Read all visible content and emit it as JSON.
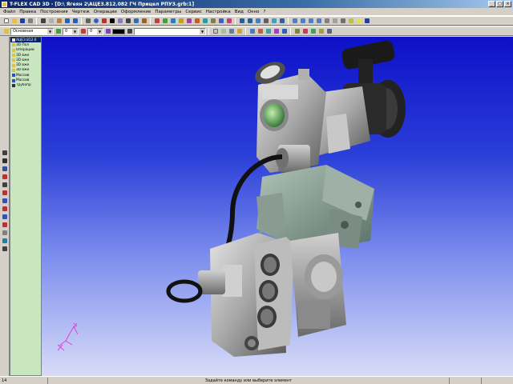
{
  "window": {
    "title": "T-FLEX CAD 3D - [D:\\ Ягеян 2\\АЦЕЗ.812.082 ГЧ Прицел РПУЗ.grb:1]",
    "buttons": [
      "_",
      "□",
      "×"
    ]
  },
  "menu": [
    "Файл",
    "Правка",
    "Построения",
    "Чертеж",
    "Операции",
    "Оформление",
    "Параметры",
    "Сервис",
    "Настройка",
    "Вид",
    "Окно",
    "?"
  ],
  "toolbar2": {
    "layer_value": "Основная",
    "level_value": "0",
    "priority_value": "0"
  },
  "tree": {
    "items": [
      {
        "label": "АЦЕЗ.812.0",
        "icon": "part-icon",
        "selected": true
      },
      {
        "label": "3D Пол",
        "icon": "folder-icon",
        "selected": false
      },
      {
        "label": "Операции",
        "icon": "folder-icon",
        "selected": false
      },
      {
        "label": "3D вже",
        "icon": "folder-icon",
        "selected": false
      },
      {
        "label": "3D вже",
        "icon": "folder-icon",
        "selected": false
      },
      {
        "label": "3D вже",
        "icon": "folder-icon",
        "selected": false
      },
      {
        "label": "3D вже",
        "icon": "folder-icon",
        "selected": false
      },
      {
        "label": "Массив",
        "icon": "array-icon",
        "selected": false
      },
      {
        "label": "Массив",
        "icon": "array-icon",
        "selected": false
      },
      {
        "label": "Трубопр",
        "icon": "pipe-icon",
        "selected": false
      }
    ]
  },
  "status": {
    "left": "14",
    "message": "Задайте команду или выберите элемент"
  },
  "colors": {
    "viewport_top": "#0d10c8",
    "viewport_bottom": "#d8dcf7",
    "tree_bg": "#c8e6c0",
    "title_bar": "#0a246a"
  }
}
